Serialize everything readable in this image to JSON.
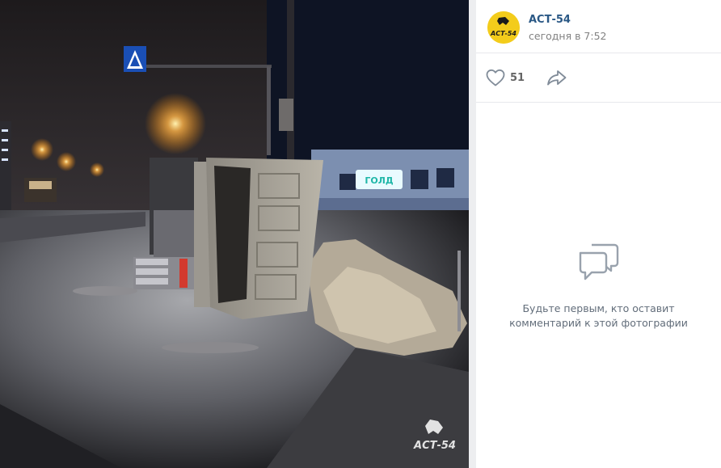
{
  "post": {
    "author": "АСТ-54",
    "time": "сегодня в 7:52"
  },
  "actions": {
    "likes": "51"
  },
  "comments": {
    "empty_line1": "Будьте первым, кто оставит",
    "empty_line2": "комментарий к этой фотографии"
  },
  "photo": {
    "watermark_text": "АСТ-54",
    "sign_text": "ГОЛД"
  },
  "colors": {
    "link": "#2a5885",
    "brand_yellow": "#f3cc1b",
    "muted": "#828282"
  },
  "icons": {
    "like": "heart-icon",
    "share": "share-arrow-icon",
    "empty_comments": "comment-bubble-icon"
  }
}
